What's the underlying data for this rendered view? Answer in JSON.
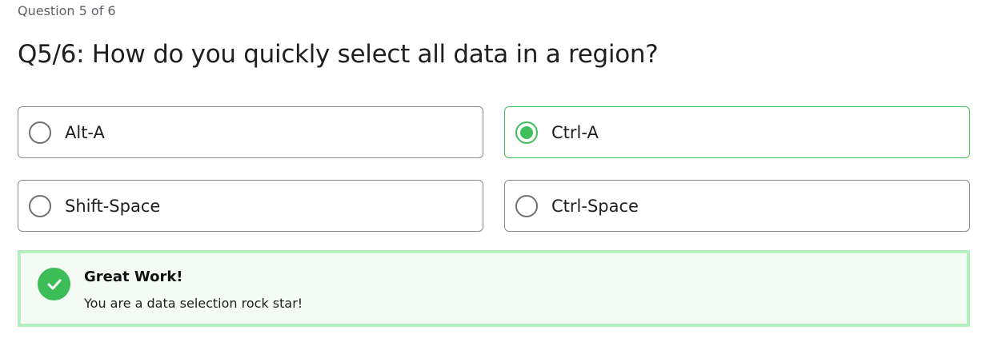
{
  "progress": {
    "label": "Question 5 of 6",
    "current": 5,
    "total": 6
  },
  "question": {
    "title": "Q5/6: How do you quickly select all data in a region?"
  },
  "options": [
    {
      "label": "Alt-A",
      "selected": false
    },
    {
      "label": "Ctrl-A",
      "selected": true
    },
    {
      "label": "Shift-Space",
      "selected": false
    },
    {
      "label": "Ctrl-Space",
      "selected": false
    }
  ],
  "feedback": {
    "title": "Great Work!",
    "message": "You are a data selection rock star!",
    "icon": "check-circle-icon",
    "status": "correct"
  },
  "colors": {
    "accent_green": "#3fc05a",
    "feedback_border": "#b3efbf",
    "feedback_background": "#f3fbf4",
    "option_border": "#8a8a8a"
  }
}
